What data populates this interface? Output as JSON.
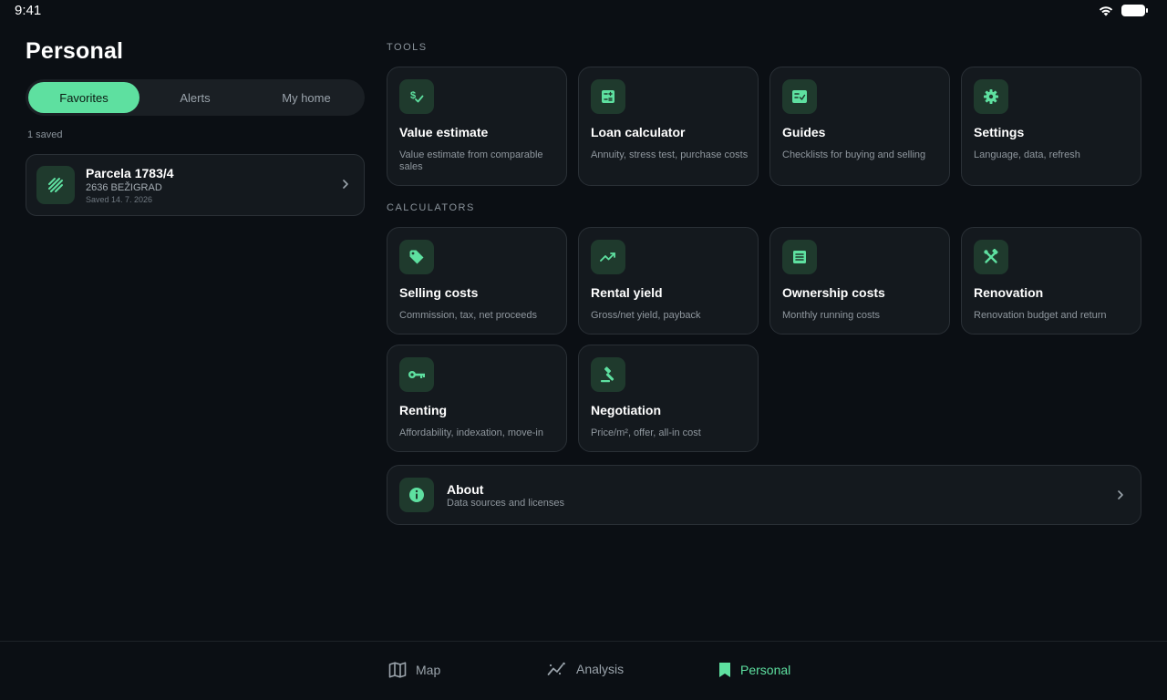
{
  "status_bar": {
    "time": "9:41"
  },
  "page_title": "Personal",
  "segments": [
    {
      "label": "Favorites",
      "active": true
    },
    {
      "label": "Alerts",
      "active": false
    },
    {
      "label": "My home",
      "active": false
    }
  ],
  "favorites": {
    "count_text": "1 saved",
    "items": [
      {
        "title": "Parcela 1783/4",
        "subtitle": "2636 BEŽIGRAD",
        "saved": "Saved 14. 7. 2026",
        "icon": "parcel-hatch-icon"
      }
    ]
  },
  "tools": {
    "label": "TOOLS",
    "items": [
      {
        "title": "Value estimate",
        "desc": "Value estimate from comparable sales",
        "icon": "price-check-icon"
      },
      {
        "title": "Loan calculator",
        "desc": "Annuity, stress test, purchase costs",
        "icon": "calculator-icon"
      },
      {
        "title": "Guides",
        "desc": "Checklists for buying and selling",
        "icon": "checklist-icon"
      },
      {
        "title": "Settings",
        "desc": "Language, data, refresh",
        "icon": "gear-icon"
      }
    ]
  },
  "calculators": {
    "label": "CALCULATORS",
    "items": [
      {
        "title": "Selling costs",
        "desc": "Commission, tax, net proceeds",
        "icon": "tag-icon"
      },
      {
        "title": "Rental yield",
        "desc": "Gross/net yield, payback",
        "icon": "trending-up-icon"
      },
      {
        "title": "Ownership costs",
        "desc": "Monthly running costs",
        "icon": "receipt-icon"
      },
      {
        "title": "Renovation",
        "desc": "Renovation budget and return",
        "icon": "tools-icon"
      },
      {
        "title": "Renting",
        "desc": "Affordability, indexation, move-in",
        "icon": "key-icon"
      },
      {
        "title": "Negotiation",
        "desc": "Price/m², offer, all-in cost",
        "icon": "gavel-icon"
      }
    ]
  },
  "about": {
    "title": "About",
    "subtitle": "Data sources and licenses",
    "icon": "info-icon"
  },
  "bottom_nav": [
    {
      "label": "Map",
      "icon": "map-icon",
      "active": false
    },
    {
      "label": "Analysis",
      "icon": "analytics-icon",
      "active": false
    },
    {
      "label": "Personal",
      "icon": "bookmark-icon",
      "active": true
    }
  ],
  "colors": {
    "accent": "#5ee0a0",
    "background": "#0b0f14",
    "card": "#14191e",
    "icon_bg": "#1f3a2d"
  }
}
